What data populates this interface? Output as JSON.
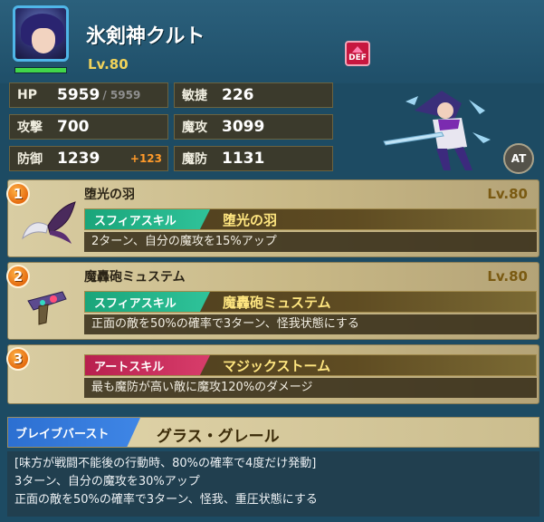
{
  "unit": {
    "name": "氷剣神クルト",
    "level": "Lv.80",
    "hp_fill": 1.0,
    "buff_badge": "DEF",
    "stats": [
      {
        "label": "HP",
        "value": "5959",
        "max": "/ 5959"
      },
      {
        "label": "敏捷",
        "value": "226"
      },
      {
        "label": "攻撃",
        "value": "700"
      },
      {
        "label": "魔攻",
        "value": "3099"
      },
      {
        "label": "防御",
        "value": "1239",
        "bonus": "+123"
      },
      {
        "label": "魔防",
        "value": "1131"
      }
    ],
    "at_button": "AT"
  },
  "skills": [
    {
      "number": "1",
      "name": "堕光の羽",
      "level": "Lv.80",
      "tag": "スフィアスキル",
      "sub_name": "堕光の羽",
      "desc": "2ターン、自分の魔攻を15%アップ",
      "icon": "wing-icon"
    },
    {
      "number": "2",
      "name": "魔轟砲ミュステム",
      "level": "Lv.80",
      "tag": "スフィアスキル",
      "sub_name": "魔轟砲ミュステム",
      "desc": "正面の敵を50%の確率で3ターン、怪我状態にする",
      "icon": "gun-icon"
    },
    {
      "number": "3",
      "tag": "アートスキル",
      "sub_name": "マジックストーム",
      "desc": "最も魔防が高い敵に魔攻120%のダメージ"
    }
  ],
  "brave_burst": {
    "tag": "ブレイブバースト",
    "name": "グラス・グレール",
    "lines": [
      "[味方が戦闘不能後の行動時、80%の確率で4度だけ発動]",
      "3ターン、自分の魔攻を30%アップ",
      "正面の敵を50%の確率で3ターン、怪我、重圧状態にする"
    ]
  },
  "colors": {
    "accent_gold": "#f1d35a",
    "sphere_tag": "#1aa57a",
    "art_tag": "#b8204e",
    "burst_tag": "#2c6fd1",
    "hp_bar": "#41d64a"
  }
}
